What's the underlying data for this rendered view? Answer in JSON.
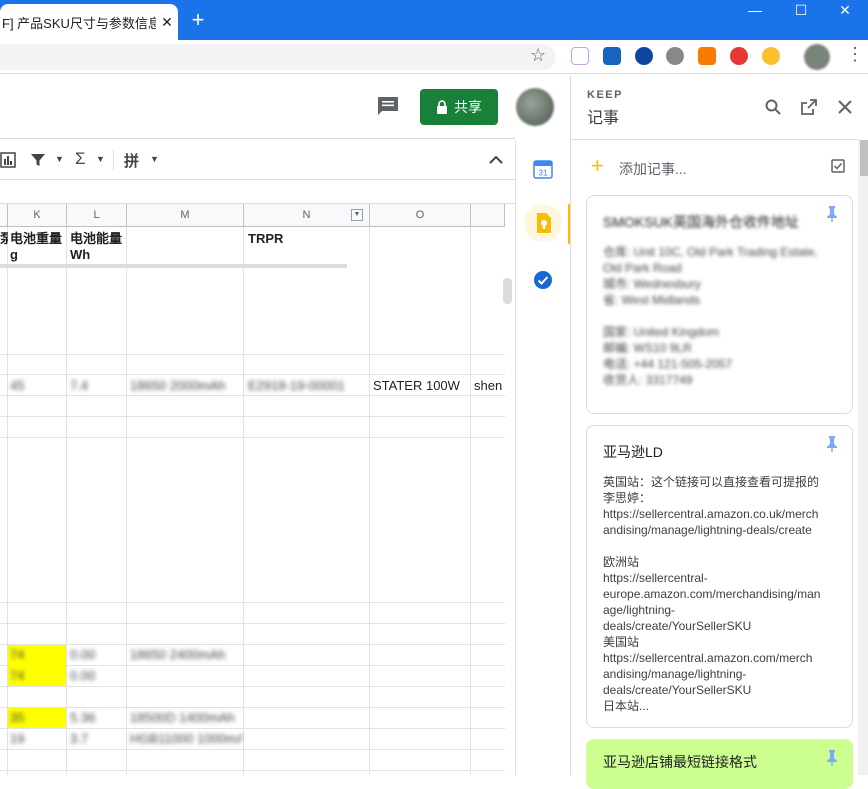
{
  "browser": {
    "tab_title": "F] 产品SKU尺寸与参数信息",
    "close_tab": "✕",
    "new_tab": "+",
    "win_min": "—",
    "win_max": "☐",
    "win_close": "✕"
  },
  "sheet": {
    "share_label": "共享",
    "toolbar": {
      "sigma": "Σ",
      "merge": "拼"
    },
    "columns": [
      "K",
      "L",
      "M",
      "N",
      "O"
    ],
    "headers": {
      "j": "泵",
      "k": "电池重量\ng",
      "l": "电池能量\nWh",
      "m": "",
      "n": "TRPR",
      "o": ""
    },
    "row1": {
      "k": "45",
      "l": "7.4",
      "m": "18650 2000mAh",
      "n": "E2918-19-00001",
      "o": "STATER 100W",
      "p": "shen"
    },
    "row2": {
      "k": "74",
      "l": "0.00",
      "m": "18650 2400mAh"
    },
    "row3": {
      "k": "74",
      "l": "0.00"
    },
    "row4": {
      "k": "35",
      "l": "5.36",
      "m": "18500D 1400mAh"
    },
    "row5": {
      "k": "19",
      "l": "3.7",
      "m": "HGB11000 1000mAh"
    }
  },
  "keep": {
    "brand": "KEEP",
    "title": "记事",
    "add_note": "添加记事...",
    "notes": [
      {
        "title": "SMOKSUK英国海外仓收件地址",
        "body": "仓库: Unit 10C, Old Park Trading Estate,\nOld Park Road\n城市: Wednesbury\n省: West Midlands\n\n国家: United Kingdom\n邮编: WS10 9LR\n电话: +44 121-505-2057\n收货人: 3317749",
        "blurred": true
      },
      {
        "title": "亚马逊LD",
        "body": "英国站：这个链接可以直接查看可提报的\n李思婷：\nhttps://sellercentral.amazon.co.uk/merch\nandising/manage/lightning-deals/create\n\n欧洲站\nhttps://sellercentral-\neurope.amazon.com/merchandising/man\nage/lightning-\ndeals/create/YourSellerSKU\n美国站\nhttps://sellercentral.amazon.com/merch\nandising/manage/lightning-\ndeals/create/YourSellerSKU\n日本站...",
        "blurred": false
      },
      {
        "title": "亚马逊店铺最短链接格式",
        "body": "",
        "blurred": false
      }
    ]
  },
  "colors": {
    "chrome_blue": "#1a73e8",
    "share_green": "#188038",
    "keep_yellow": "#fbbc04",
    "note_green": "#ccff90",
    "highlight_yellow": "#ffff00"
  }
}
